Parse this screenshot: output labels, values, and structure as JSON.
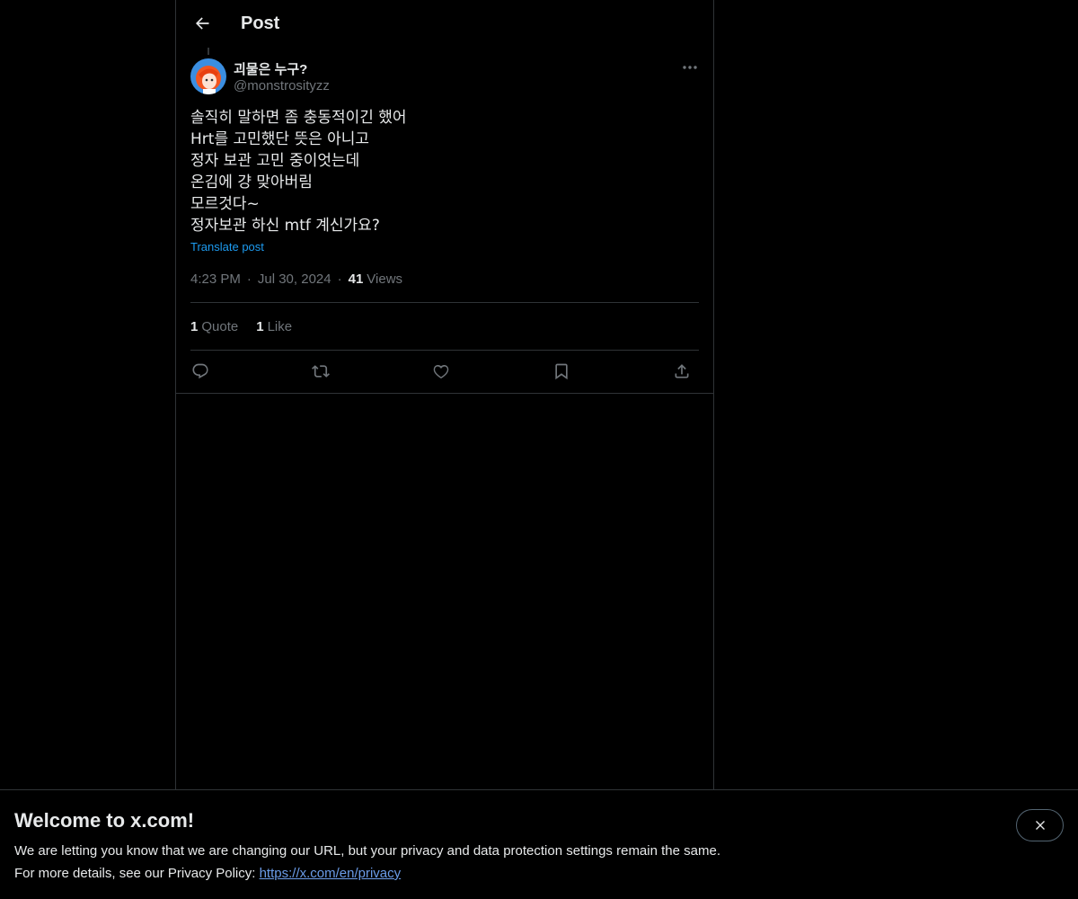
{
  "header": {
    "title": "Post"
  },
  "author": {
    "display_name": "괴물은 누구?",
    "handle": "@monstrosityzz"
  },
  "post": {
    "lines": [
      "솔직히 말하면 좀 충동적이긴 했어",
      "Hrt를 고민했단 뜻은 아니고",
      "정자 보관 고민 중이엇는데",
      "온김에 걍 맞아버림",
      "모르것다~",
      "정자보관 하신 mtf 계신가요?"
    ],
    "translate_label": "Translate post",
    "time": "4:23 PM",
    "date": "Jul 30, 2024",
    "views_count": "41",
    "views_label": "Views"
  },
  "stats": {
    "quotes_count": "1",
    "quotes_label": "Quote",
    "likes_count": "1",
    "likes_label": "Like"
  },
  "icons": {
    "back": "arrow-left-icon",
    "more": "more-horizontal-icon",
    "reply": "reply-icon",
    "repost": "repost-icon",
    "like": "heart-icon",
    "bookmark": "bookmark-icon",
    "share": "share-icon",
    "close": "close-icon"
  },
  "banner": {
    "title": "Welcome to x.com!",
    "line1": "We are letting you know that we are changing our URL, but your privacy and data protection settings remain the same.",
    "line2_prefix": "For more details, see our Privacy Policy: ",
    "privacy_link": "https://x.com/en/privacy"
  },
  "colors": {
    "background": "#000000",
    "text": "#e7e9ea",
    "muted": "#71767b",
    "accent": "#1d9bf0",
    "border": "#2f3336"
  }
}
